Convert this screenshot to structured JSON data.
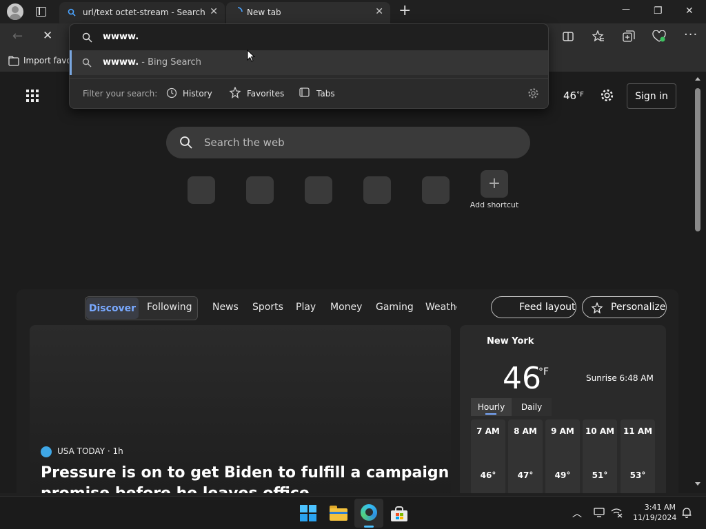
{
  "tabs": [
    {
      "title": "url/text octet-stream - Search",
      "close": "✕"
    },
    {
      "title": "New tab",
      "close": "✕"
    }
  ],
  "new_tab_symbol": "+",
  "window_controls": {
    "minimize": "—",
    "maximize": "❐",
    "close": "✕"
  },
  "favbar": {
    "import_label": "Import favor"
  },
  "omnibox": {
    "query": "wwww.",
    "suggestion_bold": "wwww.",
    "suggestion_rest": " - Bing Search",
    "filter_label": "Filter your search:",
    "filters": [
      "History",
      "Favorites",
      "Tabs"
    ]
  },
  "header": {
    "temperature": "46",
    "temp_unit": "°F",
    "sign_in": "Sign in"
  },
  "search": {
    "placeholder": "Search the web"
  },
  "shortcuts": {
    "add_label": "Add shortcut"
  },
  "feed_nav": {
    "discover": "Discover",
    "following": "Following",
    "links": [
      "News",
      "Sports",
      "Play",
      "Money",
      "Gaming",
      "Weathe"
    ],
    "feed_layout": "Feed layout",
    "personalize": "Personalize"
  },
  "news": {
    "source": "USA TODAY",
    "age": " · 1h",
    "headline_line1": "Pressure is on to get Biden to fulfill a campaign",
    "headline_line2": "promise before he leaves office"
  },
  "weather": {
    "city": "New York",
    "temp": "46",
    "unit": "°F",
    "sunrise": "Sunrise 6:48 AM",
    "tab_hourly": "Hourly",
    "tab_daily": "Daily",
    "hours": [
      {
        "time": "7 AM",
        "temp": "46°"
      },
      {
        "time": "8 AM",
        "temp": "47°"
      },
      {
        "time": "9 AM",
        "temp": "49°"
      },
      {
        "time": "10 AM",
        "temp": "51°"
      },
      {
        "time": "11 AM",
        "temp": "53°"
      }
    ]
  },
  "taskbar": {
    "time": "3:41 AM",
    "date": "11/19/2024"
  },
  "colors": {
    "accent": "#7aa7e0",
    "discover_pill": "#3a3d45"
  }
}
